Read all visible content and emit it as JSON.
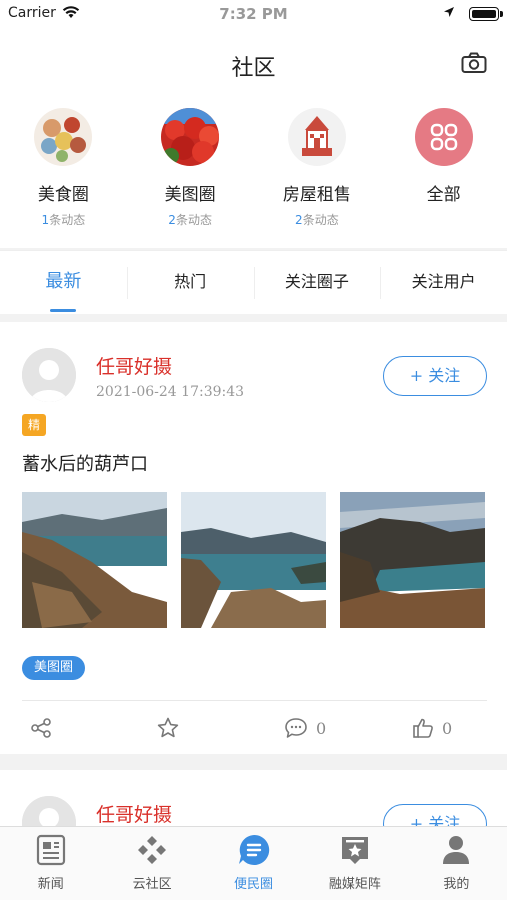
{
  "status_bar": {
    "carrier": "Carrier",
    "time": "7:32 PM"
  },
  "header": {
    "title": "社区",
    "camera_icon": "camera-icon"
  },
  "circles": [
    {
      "name": "美食圈",
      "count": "1",
      "count_suffix": "条动态"
    },
    {
      "name": "美图圈",
      "count": "2",
      "count_suffix": "条动态"
    },
    {
      "name": "房屋租售",
      "count": "2",
      "count_suffix": "条动态"
    },
    {
      "name": "全部",
      "count": "",
      "count_suffix": ""
    }
  ],
  "tabs": [
    {
      "label": "最新",
      "active": true
    },
    {
      "label": "热门",
      "active": false
    },
    {
      "label": "关注圈子",
      "active": false
    },
    {
      "label": "关注用户",
      "active": false
    }
  ],
  "posts": [
    {
      "username": "任哥好摄",
      "time": "2021-06-24 17:39:43",
      "follow_label": "+ 关注",
      "badge": "精",
      "title": "蓄水后的葫芦口",
      "tag": "美图圈",
      "comments": "0",
      "likes": "0"
    },
    {
      "username": "任哥好摄",
      "follow_label": "+ 关注"
    }
  ],
  "bottom_nav": [
    {
      "label": "新闻",
      "icon": "news-icon",
      "active": false
    },
    {
      "label": "云社区",
      "icon": "cloud-community-icon",
      "active": false
    },
    {
      "label": "便民圈",
      "icon": "convenience-circle-icon",
      "active": true
    },
    {
      "label": "融媒矩阵",
      "icon": "media-matrix-icon",
      "active": false
    },
    {
      "label": "我的",
      "icon": "profile-icon",
      "active": false
    }
  ],
  "colors": {
    "accent": "#3b8de0",
    "username": "#d9302a",
    "badge": "#f5a623"
  }
}
